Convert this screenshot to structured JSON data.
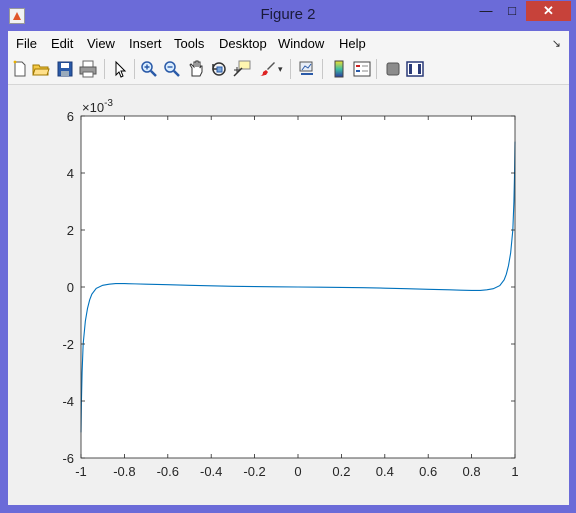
{
  "window": {
    "title": "Figure 2",
    "minimize_glyph": "—",
    "maximize_glyph": "□",
    "close_glyph": "✕"
  },
  "menu": {
    "items": [
      "File",
      "Edit",
      "View",
      "Insert",
      "Tools",
      "Desktop",
      "Window",
      "Help"
    ]
  },
  "toolbar": {
    "icons": [
      "new-figure-icon",
      "open-file-icon",
      "save-icon",
      "print-icon",
      "edit-plot-icon",
      "zoom-in-icon",
      "zoom-out-icon",
      "pan-icon",
      "rotate-3d-icon",
      "data-cursor-icon",
      "brush-icon",
      "link-plot-icon",
      "insert-colorbar-icon",
      "insert-legend-icon",
      "hide-plot-tools-icon",
      "show-plot-tools-icon"
    ]
  },
  "chart_data": {
    "type": "line",
    "title": "",
    "xlabel": "",
    "ylabel": "",
    "xlim": [
      -1,
      1
    ],
    "ylim": [
      -6,
      6
    ],
    "y_exponent_label": "×10",
    "y_exponent_power": "-3",
    "x_ticks": [
      "-1",
      "-0.8",
      "-0.6",
      "-0.4",
      "-0.2",
      "0",
      "0.2",
      "0.4",
      "0.6",
      "0.8",
      "1"
    ],
    "y_ticks": [
      "-6",
      "-4",
      "-2",
      "0",
      "2",
      "4",
      "6"
    ],
    "series": [
      {
        "color": "#0072bd",
        "x": [
          -1.0,
          -0.998,
          -0.995,
          -0.99,
          -0.98,
          -0.97,
          -0.96,
          -0.95,
          -0.93,
          -0.9,
          -0.87,
          -0.84,
          -0.8,
          -0.75,
          -0.7,
          -0.6,
          -0.5,
          -0.4,
          -0.3,
          -0.2,
          -0.1,
          0.0,
          0.1,
          0.2,
          0.3,
          0.4,
          0.5,
          0.6,
          0.7,
          0.75,
          0.8,
          0.84,
          0.87,
          0.9,
          0.93,
          0.95,
          0.96,
          0.97,
          0.98,
          0.99,
          0.995,
          0.998,
          1.0
        ],
        "y": [
          -5.1,
          -4.0,
          -3.0,
          -2.0,
          -1.2,
          -0.75,
          -0.45,
          -0.25,
          -0.05,
          0.06,
          0.1,
          0.12,
          0.12,
          0.11,
          0.1,
          0.08,
          0.06,
          0.04,
          0.025,
          0.015,
          0.005,
          0.0,
          -0.005,
          -0.015,
          -0.025,
          -0.04,
          -0.06,
          -0.08,
          -0.1,
          -0.11,
          -0.12,
          -0.12,
          -0.1,
          -0.06,
          0.05,
          0.25,
          0.45,
          0.75,
          1.2,
          2.0,
          3.0,
          4.0,
          5.1
        ]
      }
    ]
  }
}
